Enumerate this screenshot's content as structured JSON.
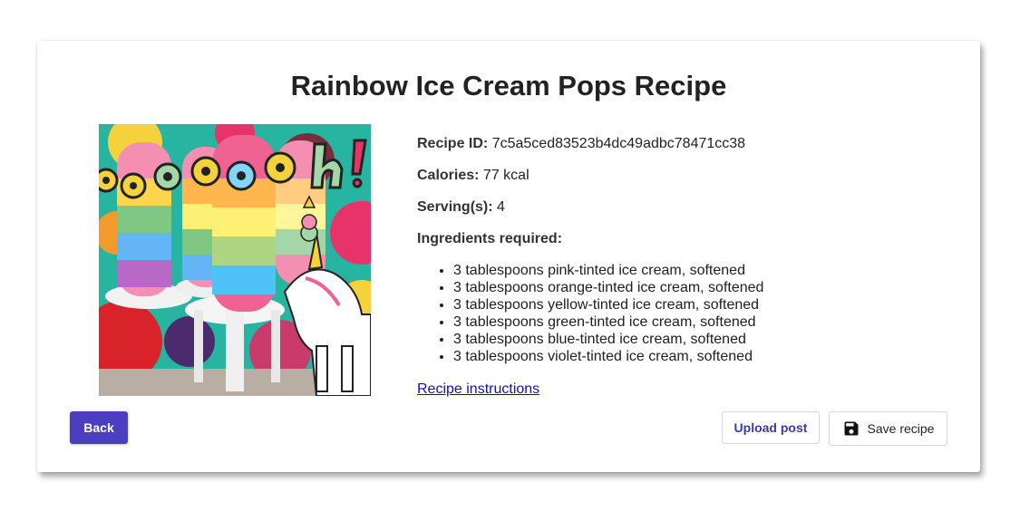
{
  "recipe": {
    "title": "Rainbow Ice Cream Pops Recipe",
    "image_alt": "Rainbow ice cream pops with a cartoon unicorn and the word Ooooooh!",
    "image_caption_text": "ooooooh!",
    "id_label": "Recipe ID:",
    "id_value": "7c5a5ced83523b4dc49adbc78471cc38",
    "calories_label": "Calories:",
    "calories_value": "77 kcal",
    "servings_label": "Serving(s):",
    "servings_value": "4",
    "ingredients_label": "Ingredients required:",
    "ingredients": [
      "3 tablespoons pink-tinted ice cream, softened",
      "3 tablespoons orange-tinted ice cream, softened",
      "3 tablespoons yellow-tinted ice cream, softened",
      "3 tablespoons green-tinted ice cream, softened",
      "3 tablespoons blue-tinted ice cream, softened",
      "3 tablespoons violet-tinted ice cream, softened"
    ],
    "instructions_link": "Recipe instructions"
  },
  "actions": {
    "back_label": "Back",
    "upload_label": "Upload post",
    "save_label": "Save recipe",
    "save_icon": "floppy-disk-icon"
  },
  "colors": {
    "primary": "#4c3fbf",
    "upload_text": "#3d3aa6",
    "link": "#1a0dab"
  }
}
